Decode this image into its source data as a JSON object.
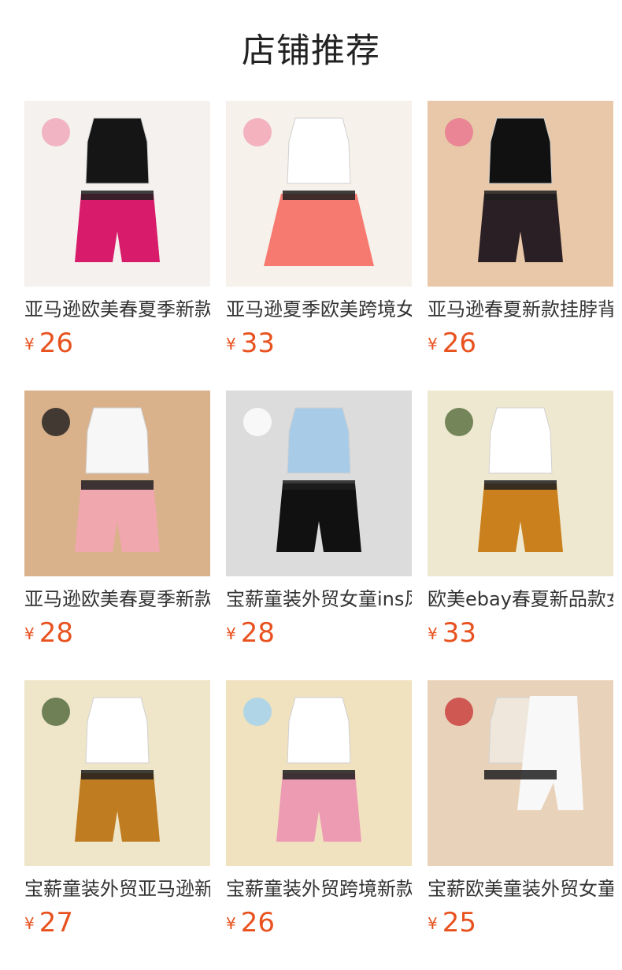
{
  "header": {
    "title": "店铺推荐"
  },
  "colors": {
    "price": "#e8521f",
    "title": "#222222",
    "text": "#333333"
  },
  "products": [
    {
      "name": "亚马逊欧美春夏季新款",
      "currency": "¥",
      "price": "26",
      "image": "black-halter-top-pink-shorts",
      "bg": "#f4f1ee",
      "top": "#151515",
      "bottom": "#d81b6a",
      "bottomStyle": "shorts",
      "accent": "#f0a5b7"
    },
    {
      "name": "亚马逊夏季欧美跨境女童",
      "currency": "¥",
      "price": "33",
      "image": "floral-top-coral-tiered-skirt",
      "bg": "#f6f1ea",
      "top": "#ffffff",
      "bottom": "#f77a70",
      "bottomStyle": "skirt",
      "accent": "#f2a2b2"
    },
    {
      "name": "亚马逊春夏新款挂脖背心",
      "currency": "¥",
      "price": "26",
      "image": "black-top-floral-shorts",
      "bg": "#e8c8a8",
      "top": "#111111",
      "bottom": "#2a1f25",
      "bottomStyle": "shorts",
      "accent": "#e9748f"
    },
    {
      "name": "亚马逊欧美春夏季新款女童",
      "currency": "¥",
      "price": "28",
      "image": "white-top-pink-pattern-shorts",
      "bg": "#d9b18b",
      "top": "#f7f7f7",
      "bottom": "#f0a7ad",
      "bottomStyle": "shorts",
      "accent": "#1b1b1b"
    },
    {
      "name": "宝薪童装外贸女童ins风",
      "currency": "¥",
      "price": "28",
      "image": "blue-top-black-leather-shorts",
      "bg": "#dcdcdc",
      "top": "#a8cce8",
      "bottom": "#111111",
      "bottomStyle": "shorts",
      "accent": "#ffffff"
    },
    {
      "name": "欧美ebay春夏新品款女童",
      "currency": "¥",
      "price": "33",
      "image": "two-sets-mustard-green-shorts",
      "bg": "#efe8d0",
      "top": "#ffffff",
      "bottom": "#c9801d",
      "bottomStyle": "shorts",
      "accent": "#556b3c"
    },
    {
      "name": "宝薪童装外贸亚马逊新款",
      "currency": "¥",
      "price": "27",
      "image": "two-sets-brown-green-shorts",
      "bg": "#efe6c9",
      "top": "#ffffff",
      "bottom": "#bf7c20",
      "bottomStyle": "shorts",
      "accent": "#4f663b"
    },
    {
      "name": "宝薪童装外贸跨境新款女童",
      "currency": "¥",
      "price": "26",
      "image": "two-sets-pink-blue-shorts",
      "bg": "#f0e1bf",
      "top": "#ffffff",
      "bottom": "#ed9ab3",
      "bottomStyle": "shorts",
      "accent": "#9fd2f0"
    },
    {
      "name": "宝薪欧美童装外贸女童连体",
      "currency": "¥",
      "price": "25",
      "image": "beige-white-rompers",
      "bg": "#e9d2ba",
      "top": "#efe7db",
      "bottom": "#f8f8f8",
      "bottomStyle": "romper",
      "accent": "#c83a3a"
    }
  ]
}
